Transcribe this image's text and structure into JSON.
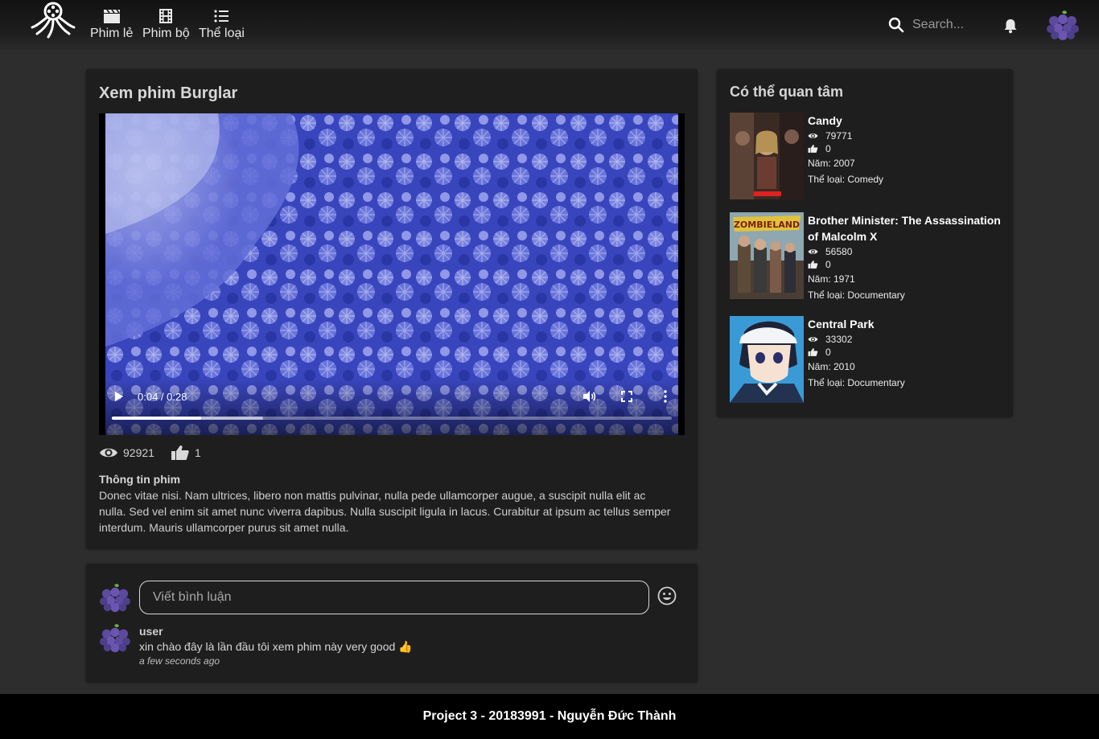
{
  "header": {
    "nav": [
      {
        "label": "Phim lẻ",
        "icon": "clapperboard-icon"
      },
      {
        "label": "Phim bộ",
        "icon": "film-strip-icon"
      },
      {
        "label": "Thể loại",
        "icon": "list-icon"
      }
    ],
    "search_placeholder": "Search...",
    "logo_icon": "octopus-film-reel-logo",
    "user_avatar_icon": "grapes-avatar"
  },
  "main": {
    "title": "Xem phim Burglar",
    "video": {
      "time": "0:04 / 0:28",
      "played_fraction": 0.16,
      "buffered_fraction": 0.27
    },
    "views": "92921",
    "likes": "1",
    "info_title": "Thông tin phim",
    "info_body": "Donec vitae nisi. Nam ultrices, libero non mattis pulvinar, nulla pede ullamcorper augue, a suscipit nulla elit ac nulla. Sed vel enim sit amet nunc viverra dapibus. Nulla suscipit ligula in lacus. Curabitur at ipsum ac tellus semper interdum. Mauris ullamcorper purus sit amet nulla."
  },
  "sidebar": {
    "title": "Có thể quan tâm",
    "items": [
      {
        "title": "Candy",
        "views": "79771",
        "likes": "0",
        "year": "Năm: 2007",
        "genre": "Thể loại: Comedy"
      },
      {
        "title": "Brother Minister: The Assassination of Malcolm X",
        "views": "56580",
        "likes": "0",
        "year": "Năm: 1971",
        "genre": "Thể loại: Documentary"
      },
      {
        "title": "Central Park",
        "views": "33302",
        "likes": "0",
        "year": "Năm: 2010",
        "genre": "Thể loại: Documentary"
      }
    ]
  },
  "comments": {
    "placeholder": "Viết bình luận",
    "list": [
      {
        "user": "user",
        "text": "xin chào đây là lần đầu tôi xem phim này very good 👍",
        "time": "a few seconds ago"
      }
    ]
  },
  "footer": {
    "text": "Project 3 - 20183991 - Nguyễn Đức Thành"
  },
  "colors": {
    "background": "#2d2d2d",
    "panel": "#1e1e1e",
    "footer": "#000000",
    "video_tint": "#4a5bd6"
  }
}
